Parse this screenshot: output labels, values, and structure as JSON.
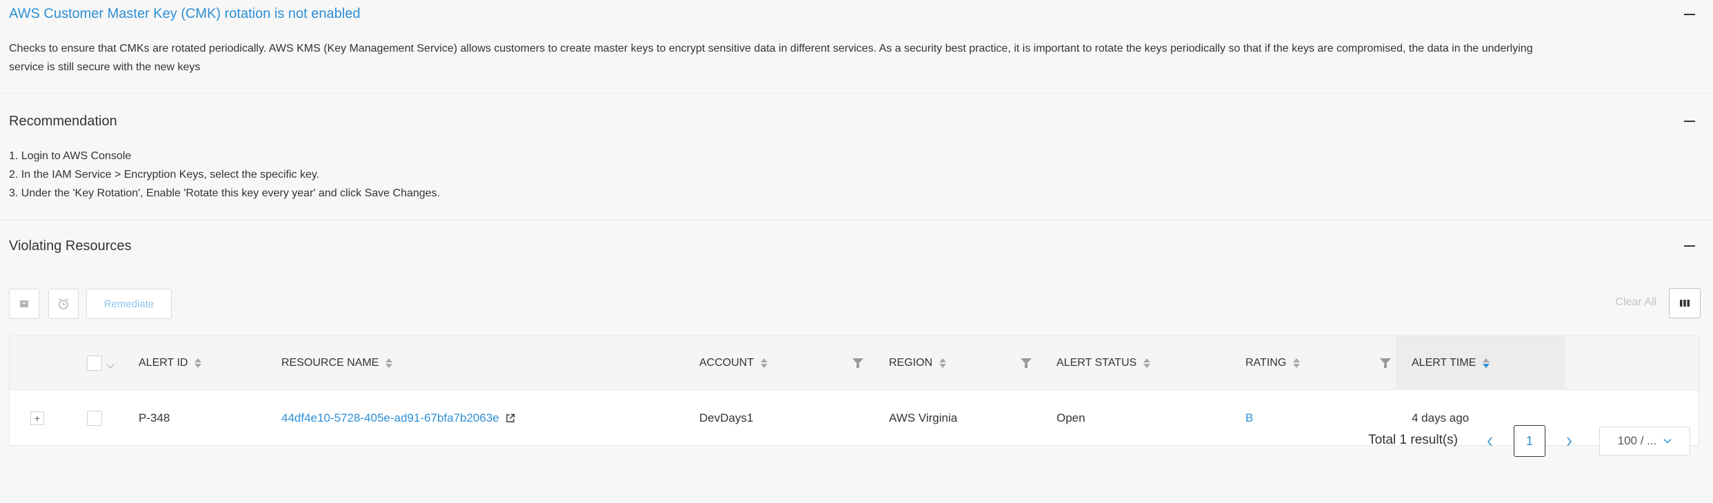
{
  "issue": {
    "title": "AWS Customer Master Key (CMK) rotation is not enabled",
    "description_line1": "Checks to ensure that CMKs are rotated periodically. AWS KMS (Key Management Service) allows customers to create master keys to encrypt sensitive data in different services. As a security best practice, it is important to rotate the keys periodically so that if the keys are compromised, the data in the underlying",
    "description_line2": "service is still secure with the new keys"
  },
  "recommendation": {
    "title": "Recommendation",
    "steps": [
      "1. Login to AWS Console",
      "2. In the IAM Service > Encryption Keys, select the specific key.",
      "3. Under the 'Key Rotation', Enable 'Rotate this key every year' and click Save Changes."
    ]
  },
  "violating_resources": {
    "title": "Violating Resources",
    "toolbar": {
      "remediate_label": "Remediate",
      "clear_all_label": "Clear All"
    },
    "columns": {
      "alert_id": "ALERT ID",
      "resource_name": "RESOURCE NAME",
      "account": "ACCOUNT",
      "region": "REGION",
      "alert_status": "ALERT STATUS",
      "rating": "RATING",
      "alert_time": "ALERT TIME"
    },
    "rows": [
      {
        "expand": "+",
        "alert_id": "P-348",
        "resource_name": "44df4e10-5728-405e-ad91-67bfa7b2063e",
        "account": "DevDays1",
        "region": "AWS Virginia",
        "alert_status": "Open",
        "rating": "B",
        "alert_time": "4 days ago"
      }
    ],
    "pagination": {
      "total": "Total 1 result(s)",
      "current_page": "1",
      "prev": "<",
      "next": ">",
      "page_size": "100 / ..."
    }
  },
  "colors": {
    "accent": "#2d8fd5",
    "text": "#333333",
    "background": "#f7f7f7"
  }
}
